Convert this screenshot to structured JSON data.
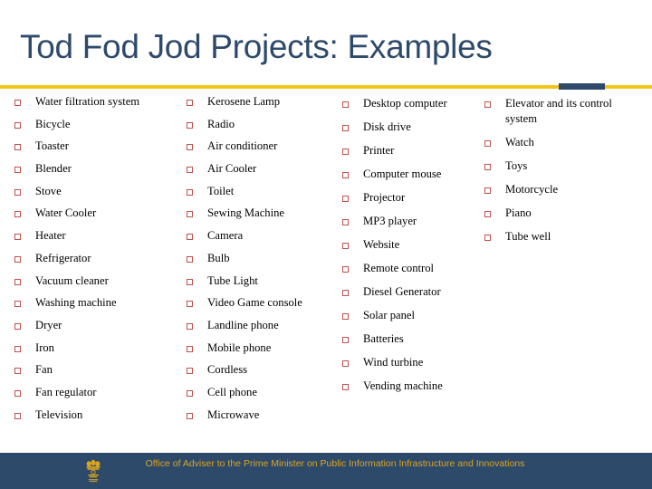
{
  "slide": {
    "title": "Tod Fod Jod Projects: Examples",
    "title_color": "#2E4A6B",
    "background_color": "#FFFFFF"
  },
  "divider": {
    "gold_color": "#F4C518",
    "navy_color": "#2E4A6B"
  },
  "bullets": {
    "glyph": "square-outline-bullet",
    "color": "#C0504D"
  },
  "columns": [
    {
      "name": "column-1",
      "items": [
        "Water filtration system",
        "Bicycle",
        "Toaster",
        "Blender",
        "Stove",
        "Water Cooler",
        "Heater",
        "Refrigerator",
        "Vacuum cleaner",
        "Washing machine",
        "Dryer",
        "Iron",
        "Fan",
        "Fan regulator",
        "Television"
      ]
    },
    {
      "name": "column-2",
      "items": [
        "Kerosene Lamp",
        "Radio",
        "Air conditioner",
        "Air Cooler",
        "Toilet",
        "Sewing Machine",
        "Camera",
        "Bulb",
        "Tube Light",
        "Video Game console",
        "Landline phone",
        "Mobile phone",
        "Cordless",
        "Cell phone",
        "Microwave"
      ]
    },
    {
      "name": "column-3",
      "items": [
        "Desktop computer",
        "Disk drive",
        "Printer",
        "Computer mouse",
        "Projector",
        "MP3 player",
        "Website",
        "Remote control",
        "Diesel Generator",
        "Solar panel",
        "Batteries",
        "Wind turbine",
        "Vending machine"
      ]
    },
    {
      "name": "column-4",
      "items": [
        "Elevator and its control system",
        "Watch",
        "Toys",
        "Motorcycle",
        "Piano",
        "Tube well"
      ]
    }
  ],
  "footer": {
    "text": "Office of Adviser to the Prime Minister on Public Information Infrastructure and Innovations",
    "background_color": "#2E4A6B",
    "text_color": "#D9A521",
    "emblem_name": "national-emblem-icon"
  }
}
